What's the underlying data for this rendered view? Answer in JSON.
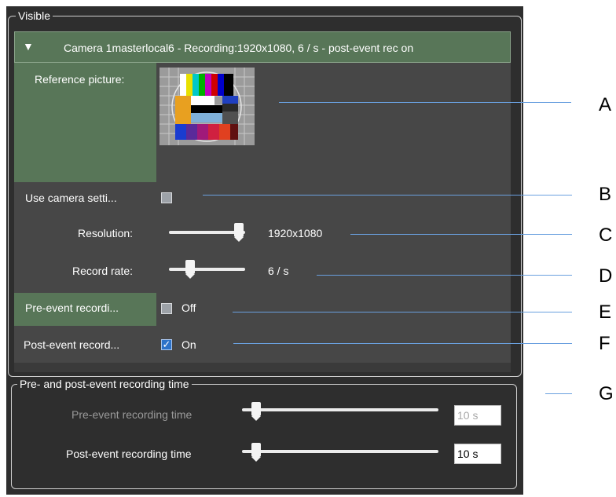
{
  "visible_group": {
    "title": "Visible"
  },
  "camera": {
    "header": "Camera 1masterlocal6 - Recording:1920x1080, 6 / s - post-event rec on",
    "reference_label": "Reference picture:",
    "use_camera_settings_label": "Use camera setti...",
    "use_camera_settings_checked": false,
    "resolution_label": "Resolution:",
    "resolution_value": "1920x1080",
    "resolution_slider_fraction": 1.0,
    "record_rate_label": "Record rate:",
    "record_rate_value": "6 / s",
    "record_rate_slider_fraction": 0.3,
    "pre_event_label": "Pre-event recordi...",
    "pre_event_checked": false,
    "pre_event_value": "Off",
    "post_event_label": "Post-event record...",
    "post_event_checked": true,
    "post_event_value": "On"
  },
  "time_group": {
    "title": "Pre- and post-event recording time",
    "pre_label": "Pre-event recording time",
    "pre_value": "10 s",
    "pre_slider_fraction": 0.05,
    "post_label": "Post-event recording time",
    "post_value": "10 s",
    "post_slider_fraction": 0.05
  },
  "callouts": {
    "a": "A",
    "b": "B",
    "c": "C",
    "d": "D",
    "e": "E",
    "f": "F",
    "g": "G"
  },
  "colors": {
    "panel_bg": "#2e2e2e",
    "content_bg": "#474747",
    "green": "#587658",
    "callout_line": "#6aa0df",
    "check_blue": "#2d72c8"
  },
  "icons": {
    "collapse": "triangle-down-icon",
    "checkmark": "checkmark-icon",
    "reference_image": "test-card-icon"
  }
}
